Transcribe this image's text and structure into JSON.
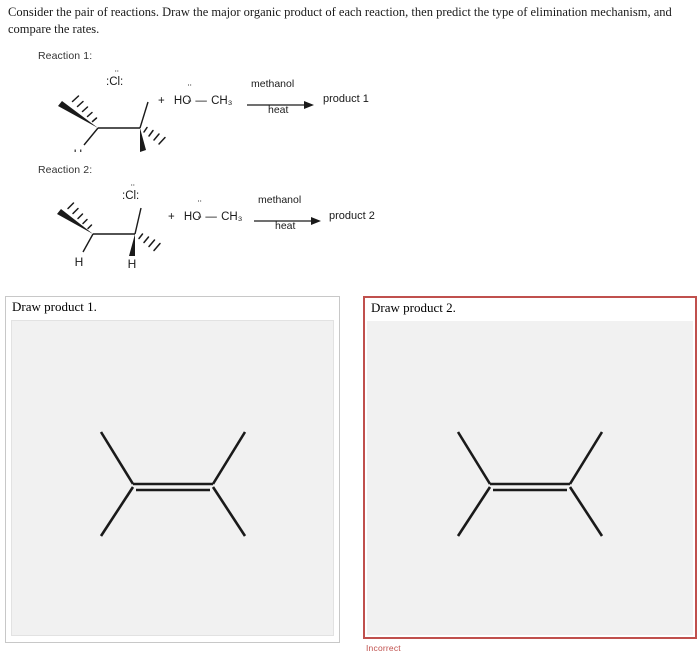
{
  "question": {
    "prompt": "Consider the pair of reactions. Draw the major organic product of each reaction, then predict the type of elimination mechanism, and compare the rates."
  },
  "reactions": [
    {
      "label": "Reaction 1:",
      "substrate": {
        "halogen_label": ":Cl:",
        "hydrogen_labels": [
          "H"
        ],
        "description": "secondary alkyl chloride with one beta hydrogen shown"
      },
      "plus_sign": "+",
      "reagent": {
        "hydroxyl_label": "HO",
        "alkyl_label": "CH3",
        "alkyl_display": "CH₃",
        "bond": "—"
      },
      "conditions": {
        "above": "methanol",
        "below": "heat"
      },
      "product_label": "product 1"
    },
    {
      "label": "Reaction 2:",
      "substrate": {
        "halogen_label": ":Cl:",
        "hydrogen_labels": [
          "H",
          "H"
        ],
        "description": "secondary alkyl chloride with two beta hydrogens shown"
      },
      "plus_sign": "+",
      "reagent": {
        "hydroxyl_label": "HO",
        "alkyl_label": "CH3",
        "alkyl_display": "CH₃",
        "bond": "—"
      },
      "conditions": {
        "above": "methanol",
        "below": "heat"
      },
      "product_label": "product 2"
    }
  ],
  "answer_boxes": [
    {
      "header": "Draw product 1.",
      "state": "neutral",
      "verdict": "",
      "drawing": {
        "type": "tetrasubstituted-alkene",
        "bond_order": 2,
        "substituent_count": 4
      }
    },
    {
      "header": "Draw product 2.",
      "state": "incorrect",
      "verdict": "Incorrect",
      "drawing": {
        "type": "tetrasubstituted-alkene",
        "bond_order": 2,
        "substituent_count": 4
      }
    }
  ],
  "colors": {
    "incorrect": "#c0504d",
    "neutral_border": "#c8c8c8",
    "canvas_bg": "#f1f1f1",
    "bond": "#1a1a1a"
  }
}
